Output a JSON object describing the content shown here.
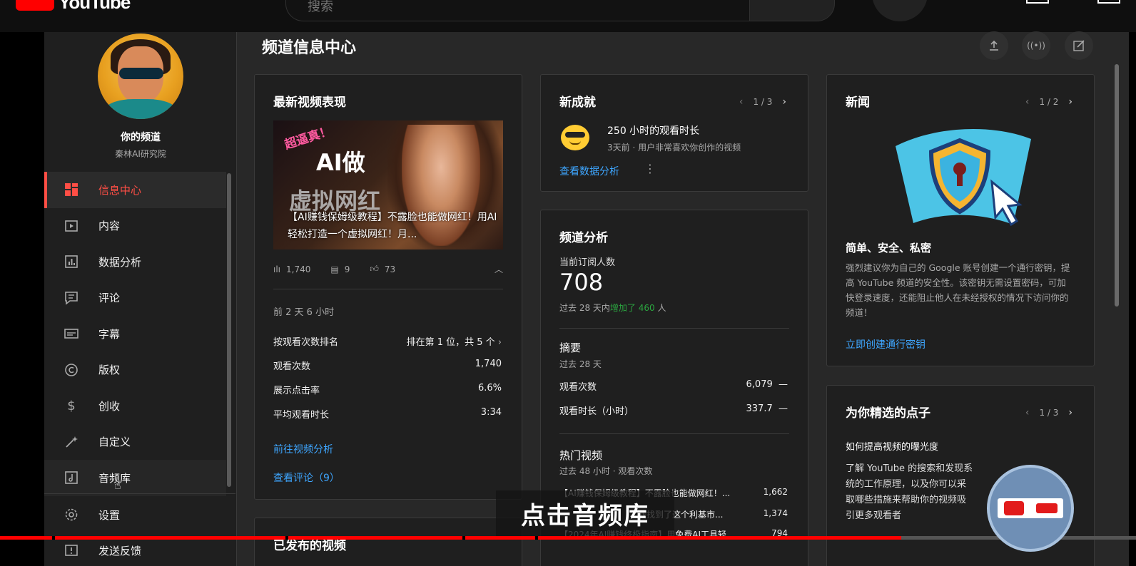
{
  "app": {
    "logo_text": "YouTube"
  },
  "search": {
    "placeholder": "搜索"
  },
  "sidebar": {
    "channel_title": "你的频道",
    "channel_name": "秦林AI研究院",
    "items": [
      {
        "label": "信息中心",
        "icon": "dashboard-icon"
      },
      {
        "label": "内容",
        "icon": "content-icon"
      },
      {
        "label": "数据分析",
        "icon": "analytics-icon"
      },
      {
        "label": "评论",
        "icon": "comments-icon"
      },
      {
        "label": "字幕",
        "icon": "subtitles-icon"
      },
      {
        "label": "版权",
        "icon": "copyright-icon"
      },
      {
        "label": "创收",
        "icon": "dollar-icon"
      },
      {
        "label": "自定义",
        "icon": "magic-wand-icon"
      },
      {
        "label": "音频库",
        "icon": "audio-library-icon"
      }
    ],
    "bottom": [
      {
        "label": "设置",
        "icon": "gear-icon"
      },
      {
        "label": "发送反馈",
        "icon": "feedback-icon"
      }
    ]
  },
  "main": {
    "title": "频道信息中心"
  },
  "latest_video": {
    "title": "最新视频表现",
    "thumb_badge": "超逼真！",
    "thumb_line1": "AI做",
    "thumb_line2": "虚拟网红",
    "thumb_caption": "【AI赚钱保姆级教程】不露脸也能做网红！用AI轻松打造一个虚拟网红！月...",
    "views": "1,740",
    "comments": "9",
    "likes": "73",
    "time_since": "前 2 天 6 小时",
    "rank_label": "按观看次数排名",
    "rank_value": "排在第 1 位，共 5 个",
    "rows": [
      {
        "label": "观看次数",
        "value": "1,740"
      },
      {
        "label": "展示点击率",
        "value": "6.6%"
      },
      {
        "label": "平均观看时长",
        "value": "3:34"
      }
    ],
    "link_analytics": "前往视频分析",
    "link_comments": "查看评论（9）"
  },
  "published": {
    "title": "已发布的视频"
  },
  "achievements": {
    "title": "新成就",
    "pager": "1 / 3",
    "headline": "250 小时的观看时长",
    "detail": "3天前 · 用户非常喜欢你创作的视频",
    "link": "查看数据分析"
  },
  "analytics": {
    "title": "频道分析",
    "subs_label": "当前订阅人数",
    "subs_value": "708",
    "subs_change_prefix": "过去 28 天内",
    "subs_change": "增加了 460",
    "subs_change_suffix": " 人",
    "summary_title": "摘要",
    "summary_period": "过去 28 天",
    "summary_rows": [
      {
        "label": "观看次数",
        "value": "6,079",
        "trend": "—"
      },
      {
        "label": "观看时长（小时）",
        "value": "337.7",
        "trend": "—"
      }
    ],
    "top_title": "热门视频",
    "top_period": "过去 48 小时 · 观看次数",
    "top_videos": [
      {
        "title": "【AI赚钱保姆级教程】不露脸也能做网红！...",
        "value": "1,662"
      },
      {
        "title": "我找到了这个利基市...",
        "value": "1,374"
      },
      {
        "title": "【2024年AI赚钱终极指南】用免费AI工具轻...",
        "value": "794"
      }
    ]
  },
  "news": {
    "title": "新闻",
    "pager": "1 / 2",
    "headline": "简单、安全、私密",
    "body": "强烈建议你为自己的 Google 账号创建一个通行密钥，提高 YouTube 频道的安全性。该密钥无需设置密码，可加快登录速度，还能阻止他人在未经授权的情况下访问你的频道！",
    "link": "立即创建通行密钥"
  },
  "ideas": {
    "title": "为你精选的点子",
    "pager": "1 / 3",
    "headline": "如何提高视频的曝光度",
    "body": "了解 YouTube 的搜索和发现系统的工作原理，以及你可以采取哪些措施来帮助你的视频吸引更多观看者"
  },
  "overlay": {
    "subtitle": "点击音频库"
  },
  "colors": {
    "accent_red": "#ff4e45",
    "link_blue": "#3ea6ff",
    "growth_green": "#2ba640"
  }
}
